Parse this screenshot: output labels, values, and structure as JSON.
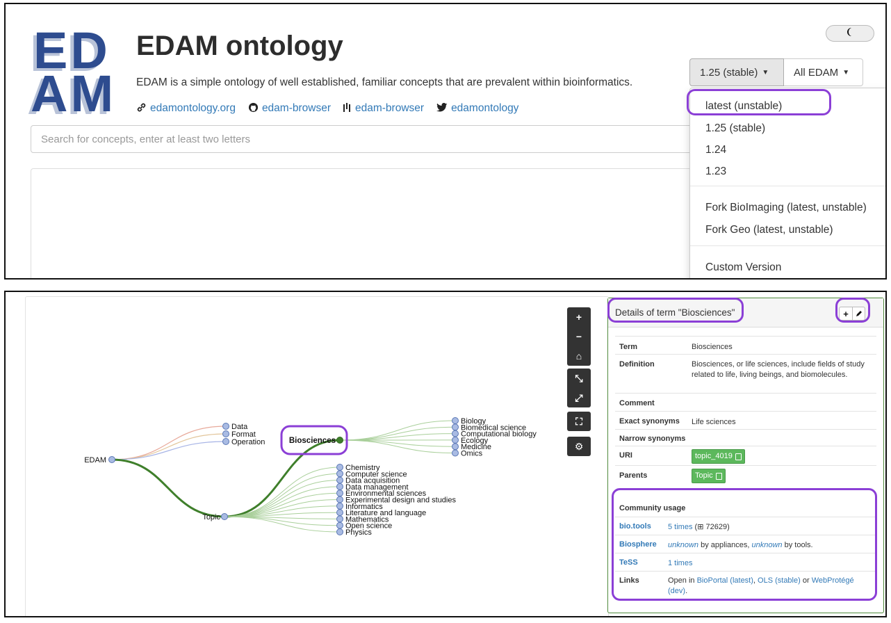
{
  "header": {
    "logo_row1": "ED",
    "logo_row2": "AM",
    "title": "EDAM ontology",
    "subtitle": "EDAM is a simple ontology of well established, familiar concepts that are prevalent within bioinformatics.",
    "links": [
      {
        "label": "edamontology.org",
        "icon": "link-icon"
      },
      {
        "label": "edam-browser",
        "icon": "github-icon"
      },
      {
        "label": "edam-browser",
        "icon": "bars-icon"
      },
      {
        "label": "edamontology",
        "icon": "twitter-icon"
      }
    ]
  },
  "search": {
    "placeholder": "Search for concepts, enter at least two letters"
  },
  "version_selector": {
    "selected": "1.25 (stable)",
    "scope": "All EDAM",
    "options": [
      "latest (unstable)",
      "1.25 (stable)",
      "1.24",
      "1.23",
      "Fork BioImaging (latest, unstable)",
      "Fork Geo (latest, unstable)",
      "Custom Version"
    ]
  },
  "tree": {
    "root": "EDAM",
    "level1": [
      "Data",
      "Format",
      "Operation",
      "Topic"
    ],
    "selected": "Biosciences",
    "biosciences_children": [
      "Biology",
      "Biomedical science",
      "Computational biology",
      "Ecology",
      "Medicine",
      "Omics"
    ],
    "topic_children": [
      "Chemistry",
      "Computer science",
      "Data acquisition",
      "Data management",
      "Environmental sciences",
      "Experimental design and studies",
      "Informatics",
      "Literature and language",
      "Mathematics",
      "Open science",
      "Physics"
    ],
    "colors": {
      "selected_path": "#3f7f2b",
      "branch": "#a9cf9a",
      "data": "#e8a99a",
      "format": "#e2c59a",
      "operation": "#a7b4e6",
      "node": "#a9bbe3"
    }
  },
  "toolbar": {
    "zoom_in": "+",
    "zoom_out": "−",
    "home": "⌂",
    "collapse": "⤡",
    "expand": "⤢",
    "fullscreen": "⛶",
    "settings": "⚙"
  },
  "details": {
    "heading": "Details of term \"Biosciences\"",
    "term_label": "Term",
    "term": "Biosciences",
    "definition_label": "Definition",
    "definition": "Biosciences, or life sciences, include fields of study related to life, living beings, and biomolecules.",
    "comment_label": "Comment",
    "exact_synonyms_label": "Exact synonyms",
    "exact_synonyms": "Life sciences",
    "narrow_synonyms_label": "Narrow synonyms",
    "uri_label": "URI",
    "uri": "topic_4019",
    "parents_label": "Parents",
    "parent": "Topic",
    "community_heading": "Community usage",
    "biotools_label": "bio.tools",
    "biotools_times": "5 times",
    "biotools_total": "72629)",
    "biotools_open": "(",
    "biosphere_label": "Biosphere",
    "biosphere_unknown1": "unknown",
    "biosphere_mid": "by appliances,",
    "biosphere_unknown2": "unknown",
    "biosphere_end": "by tools.",
    "tess_label": "TeSS",
    "tess_times": "1 times",
    "links_label": "Links",
    "links_prefix": "Open in",
    "link_bioportal": "BioPortal (latest)",
    "link_sep": ",",
    "link_ols": "OLS (stable)",
    "link_or": "or",
    "link_webprotege": "WebProtégé (dev)",
    "link_end": "."
  }
}
